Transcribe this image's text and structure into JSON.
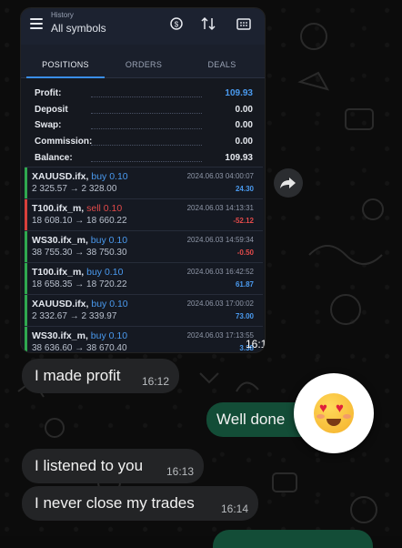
{
  "header": {
    "subtitle": "History",
    "title": "All symbols",
    "icons": [
      "currency-exchange-icon",
      "sort-icon",
      "calendar-icon"
    ]
  },
  "tabs": [
    {
      "label": "POSITIONS",
      "active": true
    },
    {
      "label": "ORDERS",
      "active": false
    },
    {
      "label": "DEALS",
      "active": false
    }
  ],
  "summary": {
    "profit_label": "Profit:",
    "profit": "109.93",
    "deposit_label": "Deposit",
    "deposit": "0.00",
    "swap_label": "Swap:",
    "swap": "0.00",
    "commission_label": "Commission:",
    "commission": "0.00",
    "balance_label": "Balance:",
    "balance": "109.93"
  },
  "positions": [
    {
      "symbol": "XAUUSD.ifx,",
      "side": "buy 0.10",
      "prices": "2 325.57 → 2 328.00",
      "time": "2024.06.03 04:00:07",
      "pl": "24.30",
      "color": "#4a9aef"
    },
    {
      "symbol": "T100.ifx_m,",
      "side": "sell 0.10",
      "prices": "18 608.10 → 18 660.22",
      "time": "2024.06.03 14:13:31",
      "pl": "-52.12",
      "color": "#e24a4a"
    },
    {
      "symbol": "WS30.ifx_m,",
      "side": "buy 0.10",
      "prices": "38 755.30 → 38 750.30",
      "time": "2024.06.03 14:59:34",
      "pl": "-0.50",
      "color": "#e24a4a"
    },
    {
      "symbol": "T100.ifx_m,",
      "side": "buy 0.10",
      "prices": "18 658.35 → 18 720.22",
      "time": "2024.06.03 16:42:52",
      "pl": "61.87",
      "color": "#4a9aef"
    },
    {
      "symbol": "XAUUSD.ifx,",
      "side": "buy 0.10",
      "prices": "2 332.67 → 2 339.97",
      "time": "2024.06.03 17:00:02",
      "pl": "73.00",
      "color": "#4a9aef"
    },
    {
      "symbol": "WS30.ifx_m,",
      "side": "buy 0.10",
      "prices": "38 636.60 → 38 670.40",
      "time": "2024.06.03 17:13:55",
      "pl": "3.38",
      "color": "#4a9aef"
    }
  ],
  "screenshot_time": "16:12",
  "messages": [
    {
      "text": "I made profit",
      "time": "16:12",
      "direction": "incoming"
    },
    {
      "text": "Well done",
      "time": "",
      "direction": "outgoing"
    },
    {
      "text": "I listened to you",
      "time": "16:13",
      "direction": "incoming"
    },
    {
      "text": "I never close my trades",
      "time": "16:14",
      "direction": "incoming"
    }
  ],
  "reaction_emoji": "heart-eyes-emoji",
  "colors": {
    "profit_blue": "#4a9aef",
    "loss_red": "#e24a4a",
    "buy_green_bar": "#2fa84f",
    "sell_red_bar": "#d8403b",
    "incoming_bubble": "#232426",
    "outgoing_bubble": "#134d37"
  }
}
